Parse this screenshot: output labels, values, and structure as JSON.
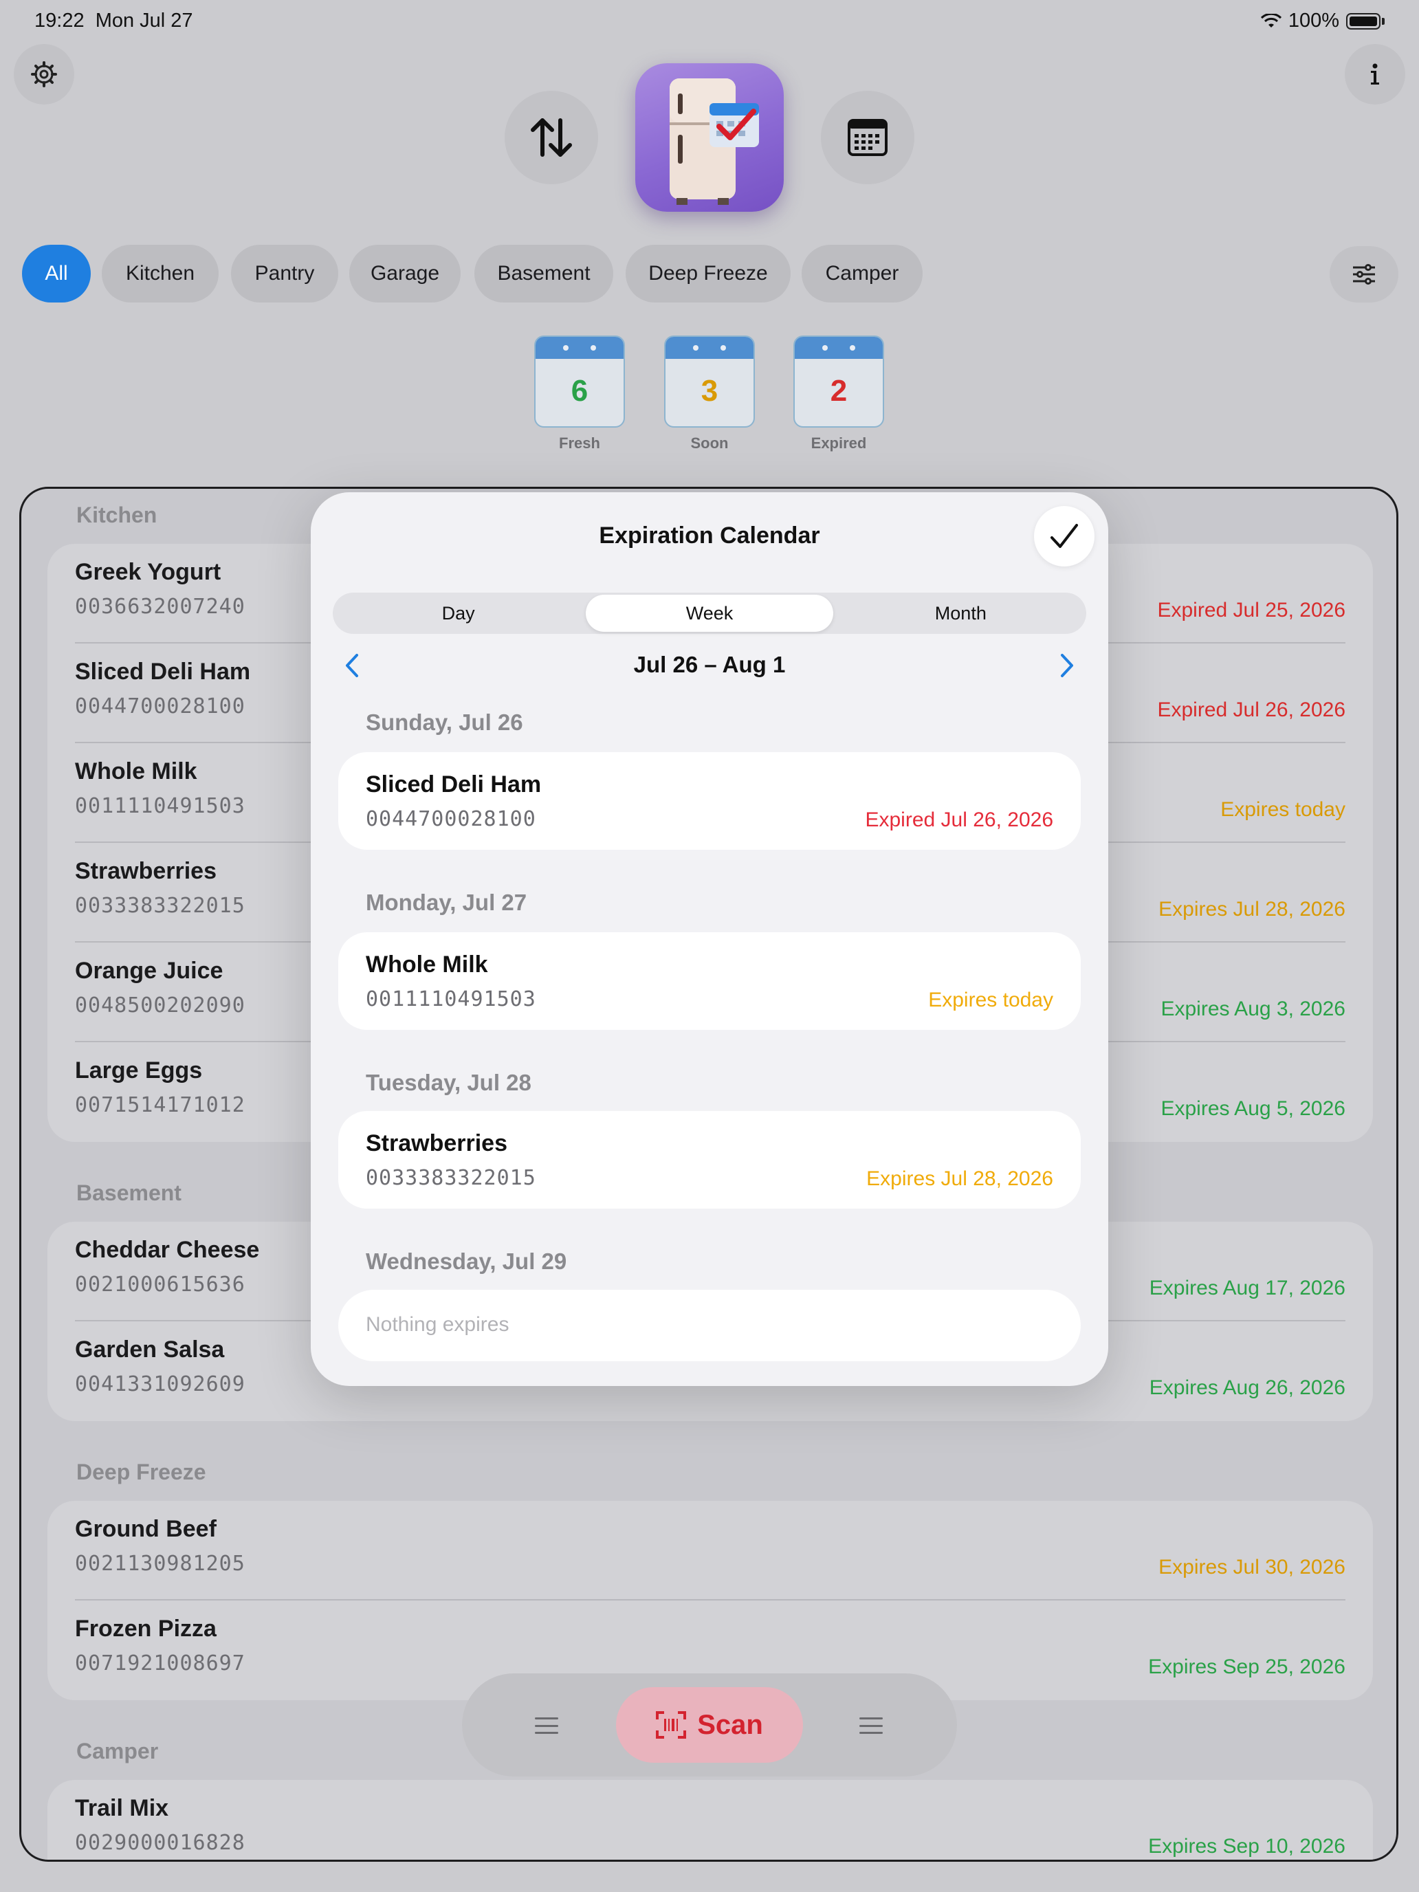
{
  "status_bar": {
    "time": "19:22",
    "date": "Mon Jul 27",
    "battery": "100%"
  },
  "filters": {
    "chips": [
      "All",
      "Kitchen",
      "Pantry",
      "Garage",
      "Basement",
      "Deep Freeze",
      "Camper"
    ],
    "selected": "All"
  },
  "stats": [
    {
      "value": "6",
      "label": "Fresh",
      "color": "#2aa148"
    },
    {
      "value": "3",
      "label": "Soon",
      "color": "#d99a06"
    },
    {
      "value": "2",
      "label": "Expired",
      "color": "#d72c2c"
    }
  ],
  "sections": [
    {
      "title": "Kitchen",
      "items": [
        {
          "name": "Greek Yogurt",
          "code": "0036632007240",
          "status": "Expired Jul 25, 2026",
          "state": "expired"
        },
        {
          "name": "Sliced Deli Ham",
          "code": "0044700028100",
          "status": "Expired Jul 26, 2026",
          "state": "expired"
        },
        {
          "name": "Whole Milk",
          "code": "0011110491503",
          "status": "Expires today",
          "state": "soon"
        },
        {
          "name": "Strawberries",
          "code": "0033383322015",
          "status": "Expires Jul 28, 2026",
          "state": "soon"
        },
        {
          "name": "Orange Juice",
          "code": "0048500202090",
          "status": "Expires Aug 3, 2026",
          "state": "fresh"
        },
        {
          "name": "Large Eggs",
          "code": "0071514171012",
          "status": "Expires Aug 5, 2026",
          "state": "fresh"
        }
      ]
    },
    {
      "title": "Basement",
      "items": [
        {
          "name": "Cheddar Cheese",
          "code": "0021000615636",
          "status": "Expires Aug 17, 2026",
          "state": "fresh"
        },
        {
          "name": "Garden Salsa",
          "code": "0041331092609",
          "status": "Expires Aug 26, 2026",
          "state": "fresh"
        }
      ]
    },
    {
      "title": "Deep Freeze",
      "items": [
        {
          "name": "Ground Beef",
          "code": "0021130981205",
          "status": "Expires Jul 30, 2026",
          "state": "soon"
        },
        {
          "name": "Frozen Pizza",
          "code": "0071921008697",
          "status": "Expires Sep 25, 2026",
          "state": "fresh"
        }
      ]
    },
    {
      "title": "Camper",
      "items": [
        {
          "name": "Trail Mix",
          "code": "0029000016828",
          "status": "Expires Sep 10, 2026",
          "state": "fresh"
        }
      ]
    }
  ],
  "modal": {
    "title": "Expiration Calendar",
    "segments": [
      "Day",
      "Week",
      "Month"
    ],
    "selected_segment": "Week",
    "range": "Jul 26 – Aug 1",
    "days": [
      {
        "heading": "Sunday, Jul 26",
        "item": {
          "name": "Sliced Deli Ham",
          "code": "0044700028100",
          "status": "Expired Jul 26, 2026",
          "state": "expired"
        }
      },
      {
        "heading": "Monday, Jul 27",
        "item": {
          "name": "Whole Milk",
          "code": "0011110491503",
          "status": "Expires today",
          "state": "soon"
        }
      },
      {
        "heading": "Tuesday, Jul 28",
        "item": {
          "name": "Strawberries",
          "code": "0033383322015",
          "status": "Expires Jul 28, 2026",
          "state": "soon"
        }
      },
      {
        "heading": "Wednesday, Jul 29",
        "empty": "Nothing expires"
      }
    ]
  },
  "bottom_bar": {
    "scan_label": "Scan"
  },
  "colors": {
    "accent": "#1f7fe0",
    "expired": "#e52c3a",
    "soon": "#f0ab0a",
    "fresh": "#2aa148",
    "scan": "#d3232f"
  },
  "icons": [
    "gear-icon",
    "info-icon",
    "sort-icon",
    "fridge-calendar-app-icon",
    "calendar-grid-icon",
    "filter-sliders-icon",
    "checkmark-icon",
    "chevron-left-icon",
    "chevron-right-icon",
    "barcode-scan-icon",
    "menu-icon"
  ]
}
